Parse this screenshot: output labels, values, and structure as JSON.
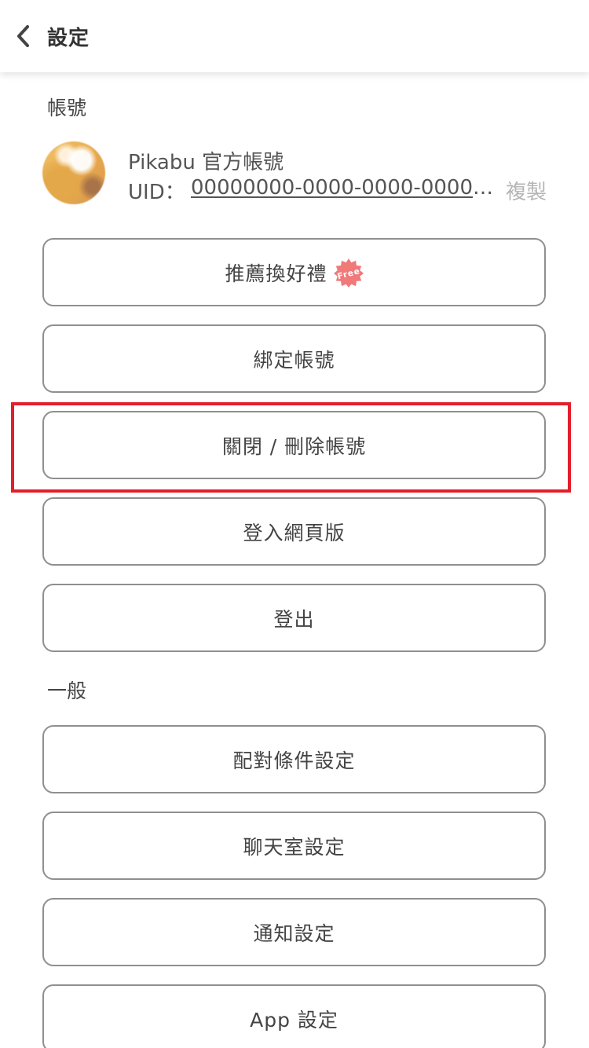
{
  "header": {
    "back_icon": "chevron-left-icon",
    "title": "設定"
  },
  "account_section": {
    "title": "帳號",
    "account": {
      "name": "Pikabu 官方帳號",
      "uid_label": "UID：",
      "uid_value": "00000000-0000-0000-0000-000000000000",
      "copy_label": "複製"
    },
    "buttons": [
      {
        "label": "推薦換好禮",
        "badge": "Free"
      },
      {
        "label": "綁定帳號"
      },
      {
        "label": "關閉 / 刪除帳號",
        "highlighted": true
      },
      {
        "label": "登入網頁版"
      },
      {
        "label": "登出"
      }
    ]
  },
  "general_section": {
    "title": "一般",
    "buttons": [
      {
        "label": "配對條件設定"
      },
      {
        "label": "聊天室設定"
      },
      {
        "label": "通知設定"
      },
      {
        "label": "App 設定"
      }
    ]
  },
  "colors": {
    "highlight": "#e41e2a",
    "badge": "#f07a7a",
    "border": "#8f8f8f"
  }
}
